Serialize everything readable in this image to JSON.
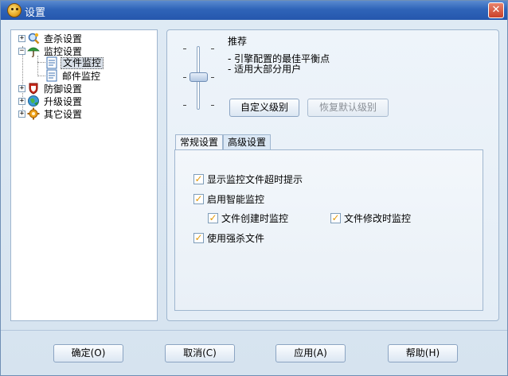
{
  "window": {
    "title": "设置",
    "close_symbol": "✕"
  },
  "tree": {
    "items": [
      {
        "label": "查杀设置",
        "expander": "+",
        "icon": "magnifier-icon"
      },
      {
        "label": "监控设置",
        "expander": "−",
        "icon": "umbrella-icon"
      },
      {
        "label": "文件监控",
        "icon": "document-icon",
        "selected": true
      },
      {
        "label": "邮件监控",
        "icon": "document-icon"
      },
      {
        "label": "防御设置",
        "expander": "+",
        "icon": "shield-icon"
      },
      {
        "label": "升级设置",
        "expander": "+",
        "icon": "globe-icon"
      },
      {
        "label": "其它设置",
        "expander": "+",
        "icon": "gear-icon"
      }
    ]
  },
  "level": {
    "name": "推荐",
    "desc": [
      "- 引擎配置的最佳平衡点",
      "- 适用大部分用户"
    ],
    "custom_button": "自定义级别",
    "restore_button": "恢复默认级别"
  },
  "tabs": [
    "常规设置",
    "高级设置"
  ],
  "options": [
    {
      "label": "显示监控文件超时提示",
      "checked": true
    },
    {
      "label": "启用智能监控",
      "checked": true
    },
    {
      "label": "文件创建时监控",
      "checked": true
    },
    {
      "label": "文件修改时监控",
      "checked": true
    },
    {
      "label": "使用强杀文件",
      "checked": true
    }
  ],
  "footer": {
    "ok": "确定(O)",
    "cancel": "取消(C)",
    "apply": "应用(A)",
    "help": "帮助(H)"
  },
  "colors": {
    "titlebar": "#2f64b8",
    "check_mark": "#e39a0b"
  }
}
